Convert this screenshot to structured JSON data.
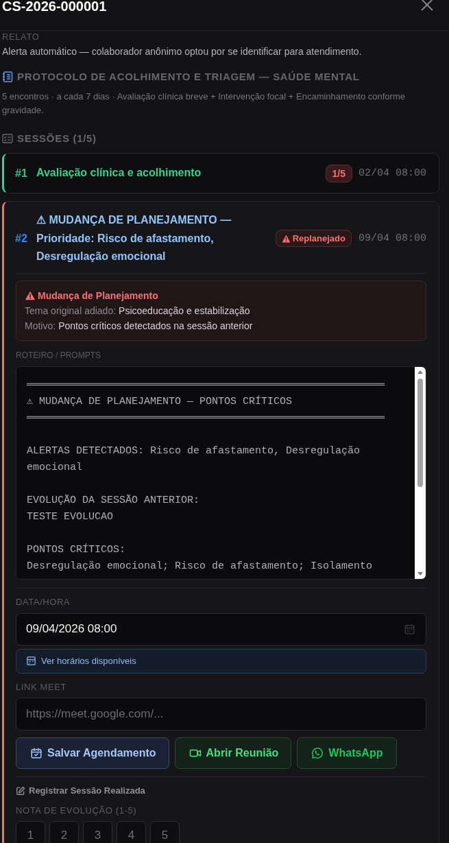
{
  "header": {
    "title": "CS-2026-000001"
  },
  "report": {
    "label": "RELATO",
    "text": "Alerta automático — colaborador anônimo optou por se identificar para atendimento."
  },
  "protocol": {
    "title": "PROTOCOLO DE ACOLHIMENTO E TRIAGEM — SAÚDE MENTAL",
    "description": "5 encontros · a cada 7 dias · Avaliação clínica breve + Intervenção focal + Encaminhamento conforme gravidade."
  },
  "sessions": {
    "heading": "SESSÕES (1/5)",
    "items": [
      {
        "kind": "completed",
        "number": "#1",
        "title": "Avaliação clínica e acolhimento",
        "badge": {
          "kind": "count",
          "text": "1/5"
        },
        "date": "02/04 08:00"
      },
      {
        "kind": "replanned",
        "number": "#2",
        "title": "⚠ MUDANÇA DE PLANEJAMENTO — Prioridade: Risco de afastamento, Desregulação emocional",
        "badge": {
          "kind": "alert",
          "text": "Replanejado"
        },
        "date": "09/04 08:00",
        "details": {
          "change_notice": {
            "title": "Mudança de Planejamento",
            "rows": [
              {
                "label": "Tema original adiado:",
                "value": "Psicoeducação e estabilização"
              },
              {
                "label": "Motivo:",
                "value": "Pontos críticos detectados na sessão anterior"
              }
            ]
          },
          "script": {
            "label": "ROTEIRO / PROMPTS",
            "blocks": [
              [
                "══════════════════════════════════════════════════════════",
                "⚠ MUDANÇA DE PLANEJAMENTO — PONTOS CRÍTICOS",
                "══════════════════════════════════════════════════════════"
              ],
              [
                "ALERTAS DETECTADOS: Risco de afastamento, Desregulação emocional"
              ],
              [
                "EVOLUÇÃO DA SESSÃO ANTERIOR:",
                "TESTE EVOLUCAO"
              ],
              [
                "PONTOS CRÍTICOS:",
                "Desregulação emocional; Risco de afastamento; Isolamento"
              ]
            ]
          },
          "datetime": {
            "label": "DATA/HORA",
            "value": "09/04/2026 08:00"
          },
          "availability_button": "Ver horários disponíveis",
          "meet_link": {
            "label": "LINK MEET",
            "placeholder": "https://meet.google.com/..."
          },
          "actions": [
            {
              "kind": "save",
              "label": "Salvar Agendamento"
            },
            {
              "kind": "meeting",
              "label": "Abrir Reunião"
            },
            {
              "kind": "whatsapp",
              "label": "WhatsApp"
            }
          ],
          "register": {
            "title": "Registrar Sessão Realizada",
            "rating_label": "NOTA DE EVOLUÇÃO (1-5)",
            "ratings": [
              {
                "label": "1",
                "selected": false
              },
              {
                "label": "2",
                "selected": false
              },
              {
                "label": "3",
                "selected": false
              },
              {
                "label": "4",
                "selected": false
              },
              {
                "label": "5",
                "selected": false
              }
            ]
          }
        }
      }
    ]
  }
}
